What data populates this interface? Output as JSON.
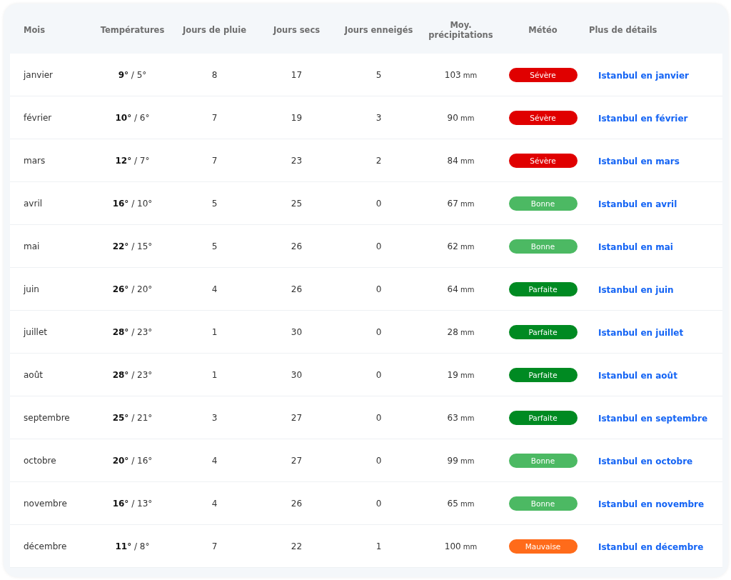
{
  "table": {
    "columns": [
      "Mois",
      "Températures",
      "Jours de pluie",
      "Jours secs",
      "Jours enneigés",
      "Moy. précipitations",
      "Météo",
      "Plus de détails"
    ],
    "rows": [
      {
        "month": "janvier",
        "temperature": "**9°** / 5°",
        "rain_days": "8",
        "dry_days": "17",
        "snow_days": "5",
        "precip": "103",
        "unit": "mm",
        "weather": {
          "label": "Sévère",
          "color": "#e00000"
        },
        "link": "Istanbul en janvier"
      },
      {
        "month": "février",
        "temperature": "**10°** / 6°",
        "rain_days": "7",
        "dry_days": "19",
        "snow_days": "3",
        "precip": "90",
        "unit": "mm",
        "weather": {
          "label": "Sévère",
          "color": "#e00000"
        },
        "link": "Istanbul en février"
      },
      {
        "month": "mars",
        "temperature": "**12°** / 7°",
        "rain_days": "7",
        "dry_days": "23",
        "snow_days": "2",
        "precip": "84",
        "unit": "mm",
        "weather": {
          "label": "Sévère",
          "color": "#e00000"
        },
        "link": "Istanbul en mars"
      },
      {
        "month": "avril",
        "temperature": "**16°** / 10°",
        "rain_days": "5",
        "dry_days": "25",
        "snow_days": "0",
        "precip": "67",
        "unit": "mm",
        "weather": {
          "label": "Bonne",
          "color": "#4cb963"
        },
        "link": "Istanbul en avril"
      },
      {
        "month": "mai",
        "temperature": "**22°** / 15°",
        "rain_days": "5",
        "dry_days": "26",
        "snow_days": "0",
        "precip": "62",
        "unit": "mm",
        "weather": {
          "label": "Bonne",
          "color": "#4cb963"
        },
        "link": "Istanbul en mai"
      },
      {
        "month": "juin",
        "temperature": "**26°** / 20°",
        "rain_days": "4",
        "dry_days": "26",
        "snow_days": "0",
        "precip": "64",
        "unit": "mm",
        "weather": {
          "label": "Parfaite",
          "color": "#008a22"
        },
        "link": "Istanbul en juin"
      },
      {
        "month": "juillet",
        "temperature": "**28°** / 23°",
        "rain_days": "1",
        "dry_days": "30",
        "snow_days": "0",
        "precip": "28",
        "unit": "mm",
        "weather": {
          "label": "Parfaite",
          "color": "#008a22"
        },
        "link": "Istanbul en juillet"
      },
      {
        "month": "août",
        "temperature": "**28°** / 23°",
        "rain_days": "1",
        "dry_days": "30",
        "snow_days": "0",
        "precip": "19",
        "unit": "mm",
        "weather": {
          "label": "Parfaite",
          "color": "#008a22"
        },
        "link": "Istanbul en août"
      },
      {
        "month": "septembre",
        "temperature": "**25°** / 21°",
        "rain_days": "3",
        "dry_days": "27",
        "snow_days": "0",
        "precip": "63",
        "unit": "mm",
        "weather": {
          "label": "Parfaite",
          "color": "#008a22"
        },
        "link": "Istanbul en septembre"
      },
      {
        "month": "octobre",
        "temperature": "**20°** / 16°",
        "rain_days": "4",
        "dry_days": "27",
        "snow_days": "0",
        "precip": "99",
        "unit": "mm",
        "weather": {
          "label": "Bonne",
          "color": "#4cb963"
        },
        "link": "Istanbul en octobre"
      },
      {
        "month": "novembre",
        "temperature": "**16°** / 13°",
        "rain_days": "4",
        "dry_days": "26",
        "snow_days": "0",
        "precip": "65",
        "unit": "mm",
        "weather": {
          "label": "Bonne",
          "color": "#4cb963"
        },
        "link": "Istanbul en novembre"
      },
      {
        "month": "décembre",
        "temperature": "**11°** / 8°",
        "rain_days": "7",
        "dry_days": "22",
        "snow_days": "1",
        "precip": "100",
        "unit": "mm",
        "weather": {
          "label": "Mauvaise",
          "color": "#ff6b1a"
        },
        "link": "Istanbul en décembre"
      }
    ]
  }
}
